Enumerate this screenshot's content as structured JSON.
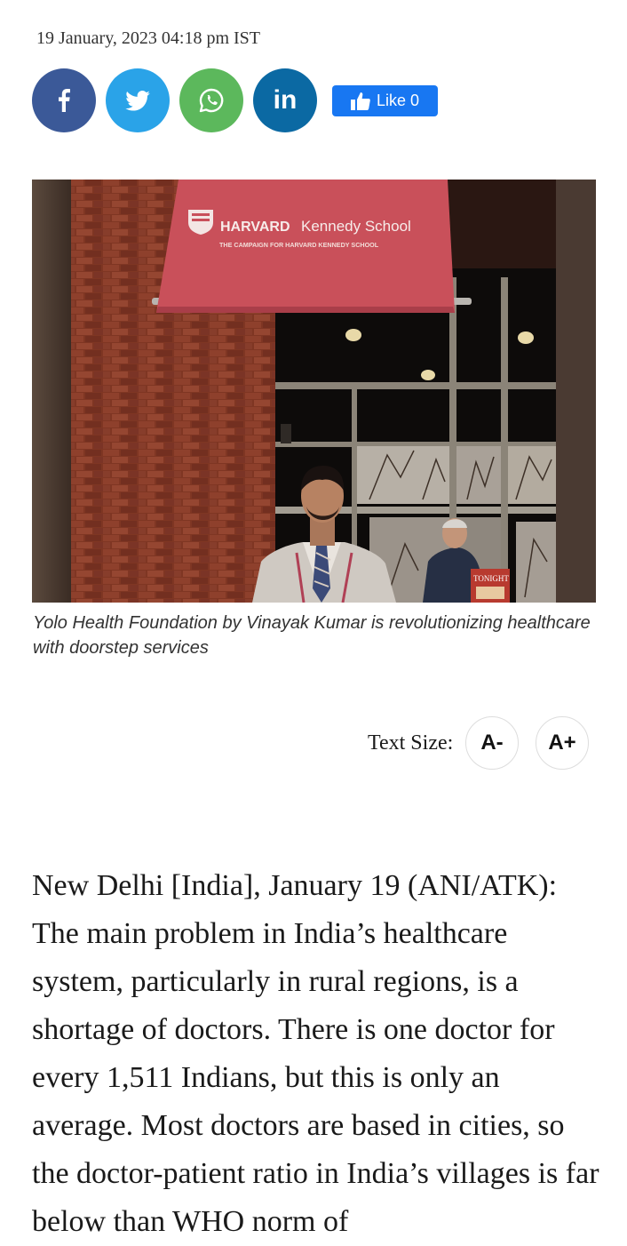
{
  "article": {
    "dateline": "19 January, 2023 04:18 pm IST",
    "caption": "Yolo Health Foundation by Vinayak Kumar is revolutionizing healthcare with doorstep services",
    "body": "New Delhi [India], January 19 (ANI/ATK): The main problem in India’s healthcare system, particularly in rural regions, is a shortage of doctors. There is one doctor for every 1,511 Indians, but this is only an average. Most doctors are based in cities, so the doctor-patient ratio in India’s villages is far below than WHO norm of"
  },
  "share": {
    "facebook_icon": "facebook-icon",
    "twitter_icon": "twitter-icon",
    "whatsapp_icon": "whatsapp-icon",
    "linkedin_label": "in",
    "like_label": "Like 0",
    "colors": {
      "facebook": "#3b5998",
      "twitter": "#2aa3e8",
      "whatsapp": "#5cb85c",
      "linkedin": "#0b69a3",
      "like": "#1877f2"
    }
  },
  "photo": {
    "banner_brand": "HARVARD",
    "banner_school": "Kennedy School",
    "banner_subtitle": "THE CAMPAIGN FOR HARVARD KENNEDY SCHOOL",
    "sign_text": "TONIGHT"
  },
  "text_size": {
    "label": "Text Size:",
    "decrease": "A-",
    "increase": "A+"
  }
}
